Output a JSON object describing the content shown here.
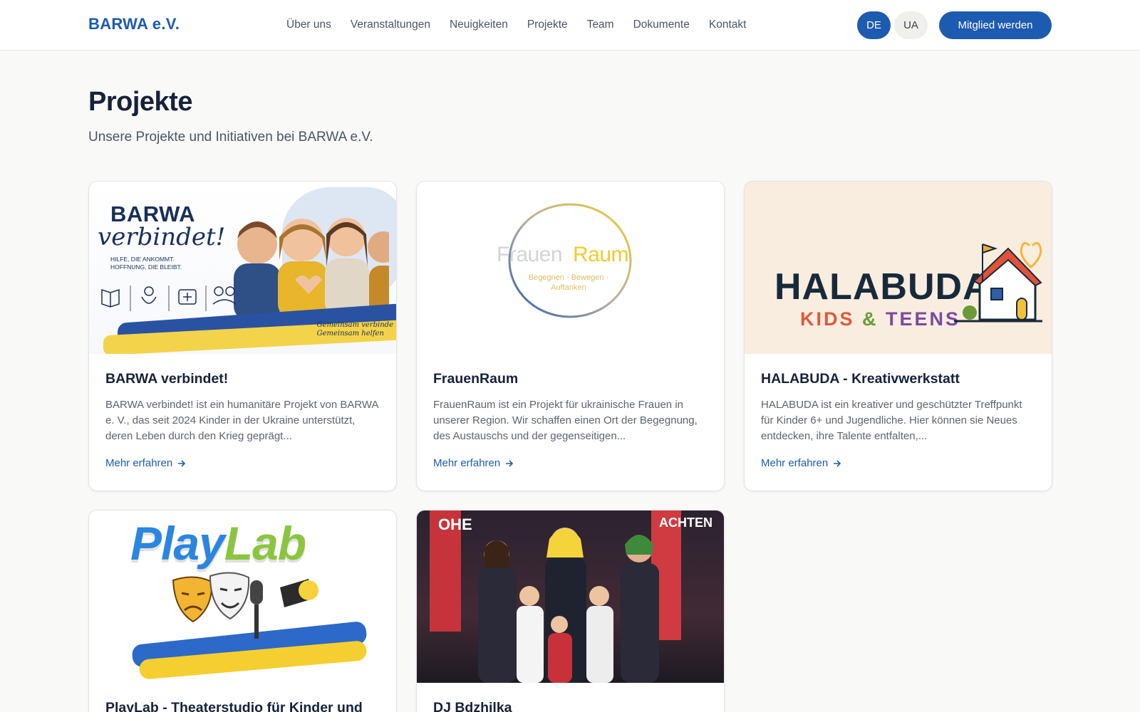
{
  "header": {
    "brand": "BARWA e.V.",
    "nav": [
      "Über uns",
      "Veranstaltungen",
      "Neuigkeiten",
      "Projekte",
      "Team",
      "Dokumente",
      "Kontakt"
    ],
    "lang_de": "DE",
    "lang_ua": "UA",
    "join_label": "Mitglied werden"
  },
  "colors": {
    "primary": "#1d5bb0",
    "background": "#f9f9f8"
  },
  "page": {
    "title": "Projekte",
    "subtitle": "Unsere Projekte und Initiativen bei BARWA e.V."
  },
  "cards": [
    {
      "title": "BARWA verbindet!",
      "text": "BARWA verbindet! ist ein humanitäre Projekt von BARWA e. V., das seit 2024 Kinder in der Ukraine unterstützt, deren Leben durch den Krieg geprägt...",
      "link": "Mehr erfahren",
      "image": {
        "t1": "BARWA",
        "t2": "verbindet!",
        "t3a": "HILFE, DIE ANKOMMT.",
        "t3b": "HOFFNUNG, DIE BLEIBT.",
        "tag1": "Gemeinsam verbinde",
        "tag2": "Gemeinsam helfen"
      }
    },
    {
      "title": "FrauenRaum",
      "text": "FrauenRaum ist ein Projekt für ukrainische Frauen in unserer Region. Wir schaffen einen Ort der Begegnung, des Austauschs und der gegenseitigen...",
      "link": "Mehr erfahren",
      "image": {
        "frauen": "Frauen",
        "raum": "Raum",
        "sub1": "Begegnen · Bewegen ·",
        "sub2": "Auftanken"
      }
    },
    {
      "title": "HALABUDA - Kreativwerkstatt",
      "text": "HALABUDA ist ein kreativer und geschützter Treffpunkt für Kinder 6+ und Jugendliche. Hier können sie Neues entdecken, ihre Talente entfalten,...",
      "link": "Mehr erfahren",
      "image": {
        "main": "HALABUDA",
        "kids": "KIDS",
        "amp": "&",
        "teens": "TEENS"
      }
    },
    {
      "title": "PlayLab - Theaterstudio für Kinder und",
      "image": {
        "play": "Play",
        "lab": "Lab"
      }
    },
    {
      "title": "DJ Bdzhilka",
      "image": {
        "left": "OHE",
        "right": "ACHTEN"
      }
    }
  ],
  "icons": {
    "arrow": "arrow-right-icon"
  }
}
